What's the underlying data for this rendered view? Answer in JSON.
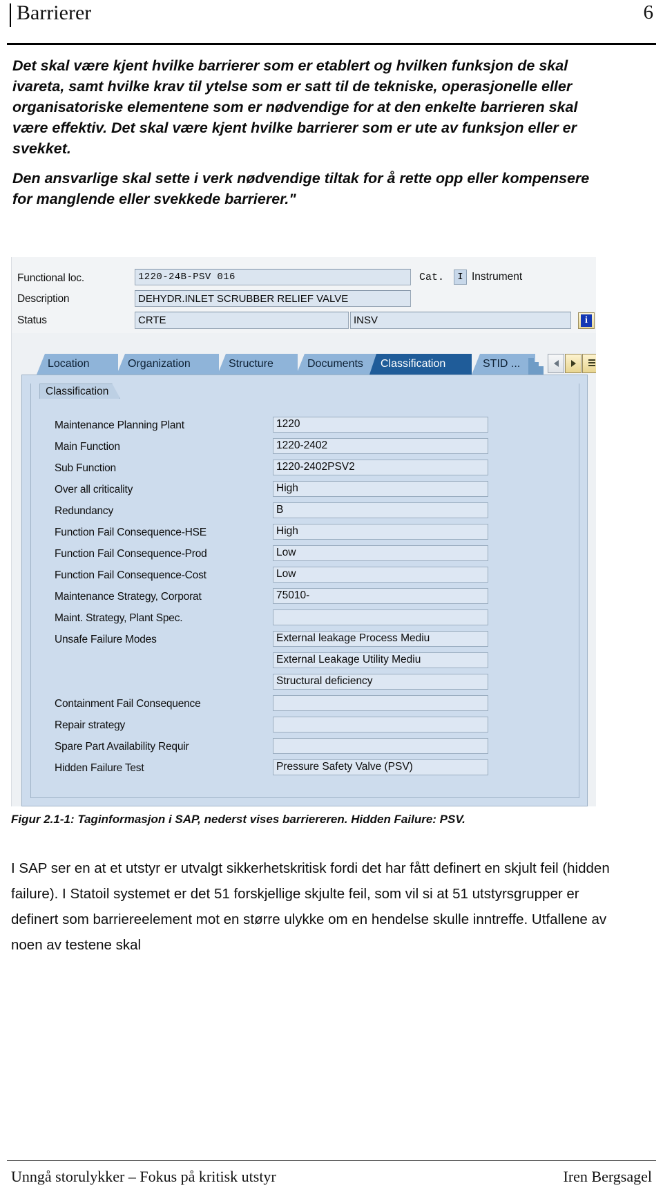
{
  "header": {
    "title": "Barrierer",
    "page_number": "6"
  },
  "quotes": [
    "Det skal være kjent hvilke barrierer som er etablert og hvilken funksjon de skal ivareta, samt hvilke krav til ytelse som er satt til de tekniske, operasjonelle eller organisatoriske elementene som er nødvendige for at den enkelte barrieren skal være effektiv. Det skal være kjent hvilke barrierer som er ute av funksjon eller er svekket.",
    "Den ansvarlige skal sette i verk nødvendige tiltak for å rette opp eller kompensere for manglende eller svekkede barrierer.\""
  ],
  "sap": {
    "head_fields": [
      {
        "label": "Functional loc.",
        "value": "1220-24B-PSV  016"
      },
      {
        "label": "Description",
        "value": "DEHYDR.INLET SCRUBBER RELIEF VALVE"
      },
      {
        "label": "Status",
        "value": "CRTE",
        "value2": "INSV"
      }
    ],
    "category": {
      "label": "Cat.",
      "code": "I",
      "text": "Instrument"
    },
    "info_button": "i",
    "tabs": [
      {
        "label": "Location",
        "active": false
      },
      {
        "label": "Organization",
        "active": false
      },
      {
        "label": "Structure",
        "active": false
      },
      {
        "label": "Documents",
        "active": false
      },
      {
        "label": "Classification",
        "active": true
      },
      {
        "label": "STID ...",
        "active": false
      }
    ],
    "tab_nav": [
      "prev-arrow-icon",
      "next-arrow-icon",
      "tab-list-icon"
    ],
    "group_title": "Classification",
    "rows": [
      {
        "label": "Maintenance Planning Plant",
        "value": "1220"
      },
      {
        "label": "Main Function",
        "value": "1220-2402"
      },
      {
        "label": "Sub Function",
        "value": "1220-2402PSV2"
      },
      {
        "label": "Over all criticality",
        "value": "High"
      },
      {
        "label": "Redundancy",
        "value": "B"
      },
      {
        "label": "Function Fail Consequence-HSE",
        "value": "High"
      },
      {
        "label": "Function Fail Consequence-Prod",
        "value": "Low"
      },
      {
        "label": "Function Fail Consequence-Cost",
        "value": "Low"
      },
      {
        "label": "Maintenance Strategy, Corporat",
        "value": "75010-"
      },
      {
        "label": "Maint. Strategy, Plant  Spec.",
        "value": ""
      },
      {
        "label": "Unsafe Failure Modes",
        "value": "External leakage Process Mediu"
      },
      {
        "label": "",
        "value": "External Leakage Utility Mediu"
      },
      {
        "label": "",
        "value": "Structural deficiency"
      },
      {
        "label": "Containment Fail Consequence",
        "value": ""
      },
      {
        "label": "Repair strategy",
        "value": ""
      },
      {
        "label": "Spare Part Availability Requir",
        "value": ""
      },
      {
        "label": "Hidden Failure Test",
        "value": "Pressure Safety Valve (PSV)"
      }
    ]
  },
  "caption": "Figur 2.1-1: Taginformasjon i SAP, nederst vises barriereren. Hidden Failure: PSV.",
  "body_text": "I SAP ser en at et utstyr er utvalgt sikkerhetskritisk fordi det har fått definert en skjult feil (hidden failure). I Statoil systemet er det 51 forskjellige skjulte feil, som vil si at 51 utstyrsgrupper er definert som barriereelement mot en større ulykke om en hendelse skulle inntreffe. Utfallene av noen av testene skal",
  "footer": {
    "left": "Unngå storulykker – Fokus på kritisk utstyr",
    "right": "Iren Bergsagel"
  },
  "colors": {
    "tab_active": "#1f5c99",
    "tab_inactive": "#8fb4d9",
    "panel_bg": "#cddced",
    "field_bg": "#dde7f3",
    "info_blue": "#1438b4"
  }
}
